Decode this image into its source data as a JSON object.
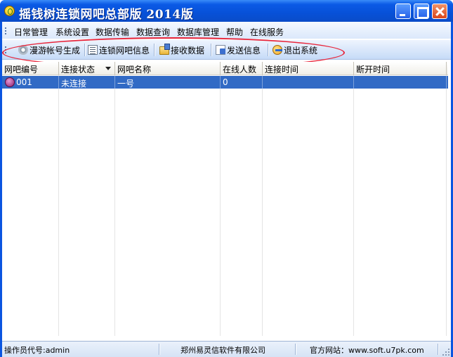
{
  "window": {
    "title": "摇钱树连锁网吧总部版 2014版"
  },
  "menu": {
    "items": [
      "日常管理",
      "系统设置",
      "数据传输",
      "数据查询",
      "数据库管理",
      "帮助",
      "在线服务"
    ]
  },
  "toolbar": {
    "items": [
      {
        "label": "漫游帐号生成",
        "icon": "gear-icon"
      },
      {
        "label": "连锁网吧信息",
        "icon": "list-icon"
      },
      {
        "label": "接收数据",
        "icon": "folder-icon"
      },
      {
        "label": "发送信息",
        "icon": "send-icon"
      },
      {
        "label": "退出系统",
        "icon": "exit-icon"
      }
    ]
  },
  "grid": {
    "columns": [
      "网吧编号",
      "连接状态",
      "网吧名称",
      "在线人数",
      "连接时间",
      "断开时间"
    ],
    "rows": [
      {
        "id": "001",
        "status": "未连接",
        "name": "一号",
        "online": "0",
        "connect_time": "",
        "disconnect_time": ""
      }
    ]
  },
  "status": {
    "operator": "操作员代号:admin",
    "company": "郑州易灵信软件有限公司",
    "website": "官方网站：www.soft.u7pk.com"
  },
  "colors": {
    "titlebar": "#0a55e0",
    "selection": "#316ac5",
    "annotation": "#e8253a"
  }
}
